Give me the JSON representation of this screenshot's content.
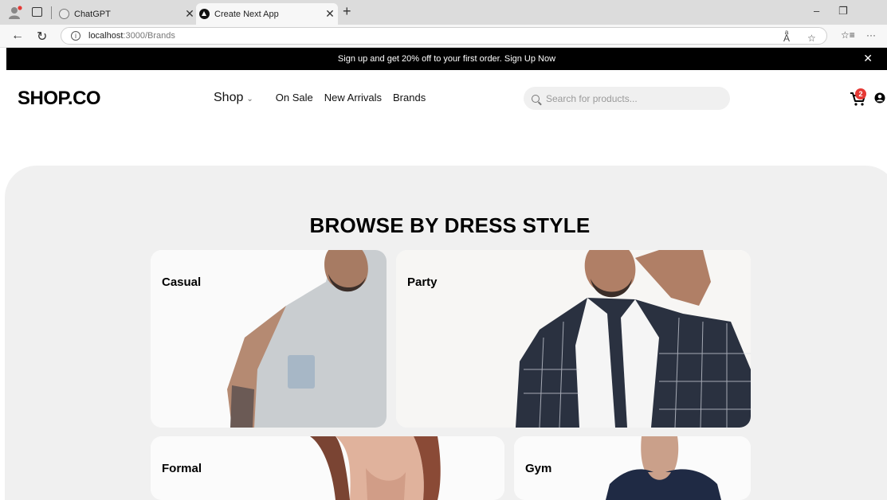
{
  "browser": {
    "tabs": [
      {
        "title": "ChatGPT",
        "active": false
      },
      {
        "title": "Create Next App",
        "active": true
      }
    ],
    "url_host": "localhost",
    "url_rest": ":3000/Brands"
  },
  "promo": {
    "text": "Sign up and get 20% off to your first order.",
    "link": "Sign Up Now"
  },
  "header": {
    "logo": "SHOP.CO",
    "nav": {
      "shop": "Shop",
      "on_sale": "On Sale",
      "new_arrivals": "New Arrivals",
      "brands": "Brands"
    },
    "search_placeholder": "Search for products...",
    "cart_count": "2"
  },
  "browse": {
    "title": "BROWSE BY DRESS STYLE",
    "categories": [
      {
        "name": "Casual"
      },
      {
        "name": "Party"
      },
      {
        "name": "Formal"
      },
      {
        "name": "Gym"
      }
    ]
  }
}
